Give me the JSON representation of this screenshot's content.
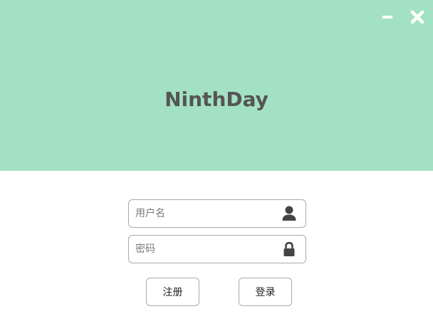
{
  "app": {
    "title": "NinthDay"
  },
  "window_controls": {
    "minimize_icon": "minimize-icon",
    "close_icon": "close-icon"
  },
  "login_form": {
    "username": {
      "placeholder": "用户名",
      "value": "",
      "icon": "user-icon"
    },
    "password": {
      "placeholder": "密码",
      "value": "",
      "icon": "lock-icon"
    }
  },
  "buttons": {
    "register_label": "注册",
    "login_label": "登录"
  },
  "colors": {
    "header_background": "#a3e1c4",
    "title_text": "#555555",
    "icon_dark": "#444444",
    "border": "#a9a9a9"
  }
}
